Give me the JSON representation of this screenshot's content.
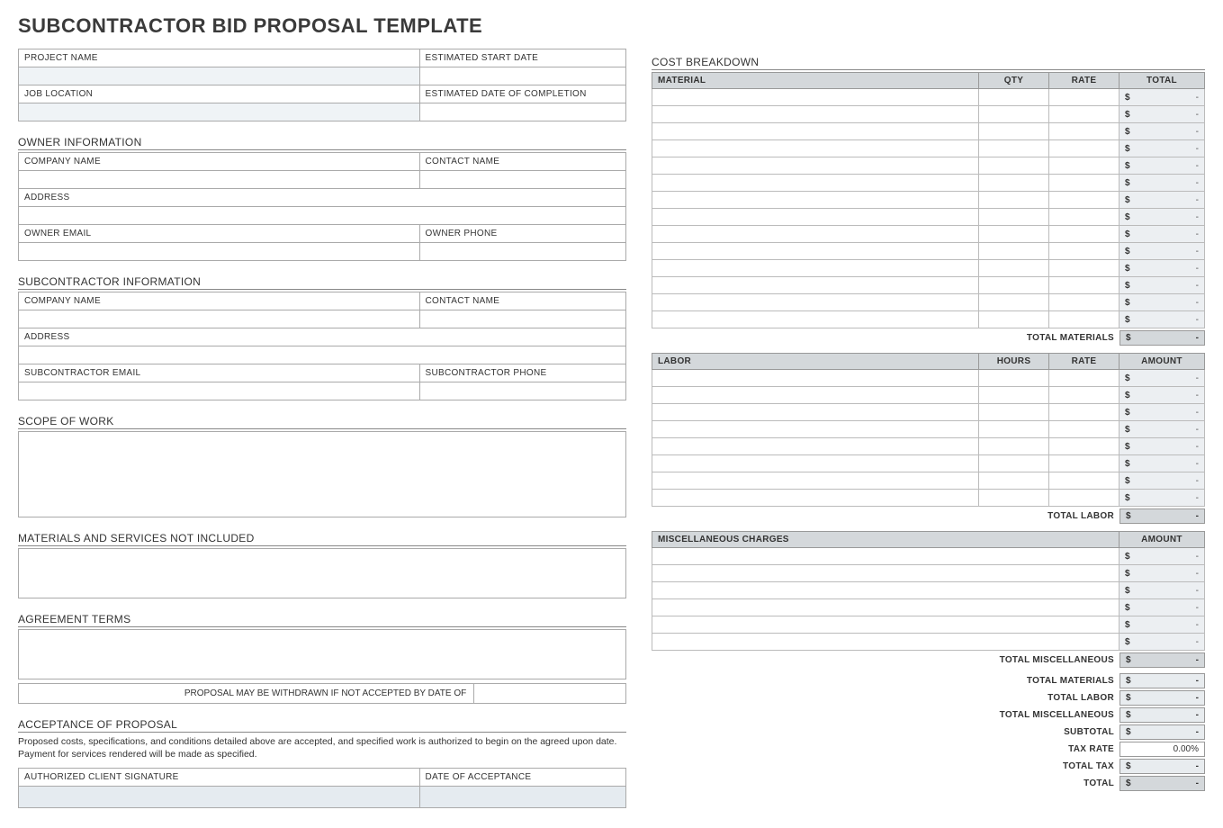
{
  "title": "SUBCONTRACTOR BID PROPOSAL TEMPLATE",
  "left": {
    "project_name_label": "PROJECT NAME",
    "est_start_label": "ESTIMATED START DATE",
    "job_location_label": "JOB LOCATION",
    "est_end_label": "ESTIMATED DATE OF COMPLETION",
    "owner_info_heading": "OWNER INFORMATION",
    "owner_company_label": "COMPANY NAME",
    "owner_contact_label": "CONTACT NAME",
    "owner_address_label": "ADDRESS",
    "owner_email_label": "OWNER EMAIL",
    "owner_phone_label": "OWNER PHONE",
    "sub_info_heading": "SUBCONTRACTOR INFORMATION",
    "sub_company_label": "COMPANY NAME",
    "sub_contact_label": "CONTACT NAME",
    "sub_address_label": "ADDRESS",
    "sub_email_label": "SUBCONTRACTOR EMAIL",
    "sub_phone_label": "SUBCONTRACTOR PHONE",
    "scope_heading": "SCOPE OF WORK",
    "not_included_heading": "MATERIALS AND SERVICES NOT INCLUDED",
    "agreement_heading": "AGREEMENT TERMS",
    "withdraw_text": "PROPOSAL MAY BE WITHDRAWN IF NOT ACCEPTED BY DATE OF",
    "acceptance_heading": "ACCEPTANCE OF PROPOSAL",
    "acceptance_para": "Proposed costs, specifications, and conditions detailed above are accepted, and specified work is authorized to begin on the agreed upon date.  Payment for services rendered will be made as specified.",
    "sig_label": "AUTHORIZED CLIENT SIGNATURE",
    "date_accept_label": "DATE OF ACCEPTANCE"
  },
  "right": {
    "heading": "COST BREAKDOWN",
    "material_hdr": "MATERIAL",
    "qty_hdr": "QTY",
    "rate_hdr": "RATE",
    "total_hdr": "TOTAL",
    "labor_hdr": "LABOR",
    "hours_hdr": "HOURS",
    "amount_hdr": "AMOUNT",
    "misc_hdr": "MISCELLANEOUS CHARGES",
    "currency": "$",
    "dash": "-",
    "total_materials_label": "TOTAL MATERIALS",
    "total_labor_label": "TOTAL LABOR",
    "total_misc_label": "TOTAL MISCELLANEOUS",
    "subtotal_label": "SUBTOTAL",
    "tax_rate_label": "TAX RATE",
    "tax_rate_value": "0.00%",
    "total_tax_label": "TOTAL TAX",
    "grand_total_label": "TOTAL",
    "material_rows": 14,
    "labor_rows": 8,
    "misc_rows": 6
  }
}
